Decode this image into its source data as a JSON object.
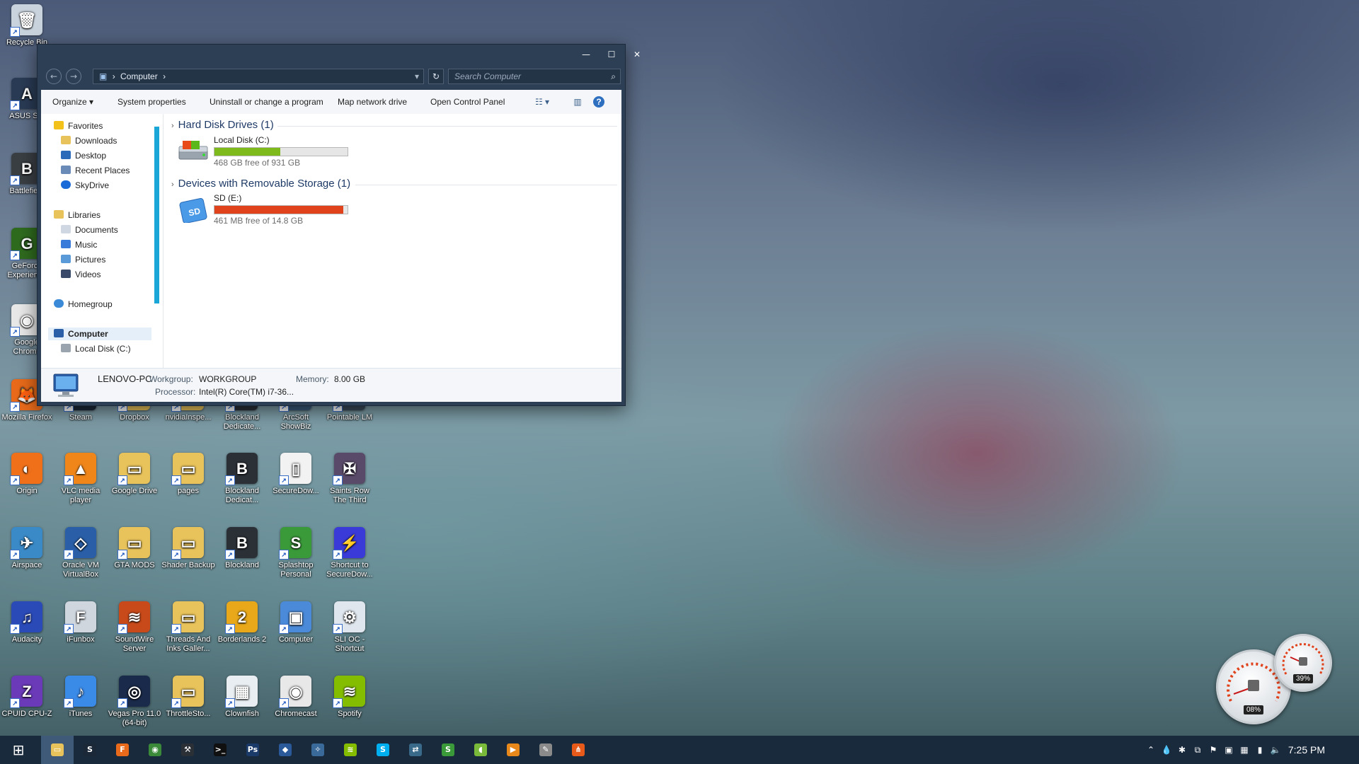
{
  "desktop": {
    "icons": [
      {
        "label": "Recycle Bin",
        "color": "#c9d3dd",
        "glyph": "🗑"
      },
      {
        "label": "ASUS S...",
        "color": "#2a3b55",
        "glyph": "A"
      },
      {
        "label": "Battlefie...",
        "color": "#3a3f44",
        "glyph": "B"
      },
      {
        "label": "GeForce Experience",
        "color": "#2f6b1f",
        "glyph": "G"
      },
      {
        "label": "Google Chrome",
        "color": "#e8e8e8",
        "glyph": "◉"
      },
      {
        "label": "Mozilla Firefox",
        "color": "#e86a1a",
        "glyph": "🦊"
      },
      {
        "label": "Steam",
        "color": "#1b2838",
        "glyph": "S"
      },
      {
        "label": "Dropbox",
        "color": "#e8c25a",
        "glyph": "▭"
      },
      {
        "label": "nvidiaInspe...",
        "color": "#e8c25a",
        "glyph": "▭"
      },
      {
        "label": "Blockland Dedicate...",
        "color": "#2b3037",
        "glyph": "B"
      },
      {
        "label": "ArcSoft ShowBiz",
        "color": "#3a5a7a",
        "glyph": "A"
      },
      {
        "label": "Pointable LM",
        "color": "#3a4a5a",
        "glyph": "P"
      },
      {
        "label": "Origin",
        "color": "#f0701a",
        "glyph": "◐"
      },
      {
        "label": "VLC media player",
        "color": "#f0861a",
        "glyph": "▲"
      },
      {
        "label": "Google Drive",
        "color": "#e8c25a",
        "glyph": "▭"
      },
      {
        "label": "pages",
        "color": "#e8c25a",
        "glyph": "▭"
      },
      {
        "label": "Blockland Dedicat...",
        "color": "#2b3037",
        "glyph": "B"
      },
      {
        "label": "SecureDow...",
        "color": "#f2f2f2",
        "glyph": "▯"
      },
      {
        "label": "Saints Row The Third",
        "color": "#5a4a6a",
        "glyph": "✠"
      },
      {
        "label": "Airspace",
        "color": "#3a8ac8",
        "glyph": "✈"
      },
      {
        "label": "Oracle VM VirtualBox",
        "color": "#2a5fa8",
        "glyph": "◇"
      },
      {
        "label": "GTA MODS",
        "color": "#e8c25a",
        "glyph": "▭"
      },
      {
        "label": "Shader Backup",
        "color": "#e8c25a",
        "glyph": "▭"
      },
      {
        "label": "Blockland",
        "color": "#2b3037",
        "glyph": "B"
      },
      {
        "label": "Splashtop Personal",
        "color": "#3a9a3a",
        "glyph": "S"
      },
      {
        "label": "Shortcut to SecureDow...",
        "color": "#3a3ad8",
        "glyph": "⚡"
      },
      {
        "label": "Audacity",
        "color": "#2a4ab8",
        "glyph": "♫"
      },
      {
        "label": "iFunbox",
        "color": "#cfd6de",
        "glyph": "F"
      },
      {
        "label": "SoundWire Server",
        "color": "#c84a1a",
        "glyph": "≋"
      },
      {
        "label": "Threads And Inks Galler...",
        "color": "#e8c25a",
        "glyph": "▭"
      },
      {
        "label": "Borderlands 2",
        "color": "#e8a81a",
        "glyph": "2"
      },
      {
        "label": "Computer",
        "color": "#4a8ad8",
        "glyph": "▣"
      },
      {
        "label": "SLI OC - Shortcut",
        "color": "#dfe6ee",
        "glyph": "⚙"
      },
      {
        "label": "CPUID CPU-Z",
        "color": "#6a3ab8",
        "glyph": "Z"
      },
      {
        "label": "iTunes",
        "color": "#3a8ae8",
        "glyph": "♪"
      },
      {
        "label": "Vegas Pro 11.0 (64-bit)",
        "color": "#1a2a4a",
        "glyph": "◎"
      },
      {
        "label": "ThrottleSto...",
        "color": "#e8c25a",
        "glyph": "▭"
      },
      {
        "label": "Clownfish",
        "color": "#e8eef2",
        "glyph": "▦"
      },
      {
        "label": "Chromecast",
        "color": "#e8e8e8",
        "glyph": "◉"
      },
      {
        "label": "Spotify",
        "color": "#84bd00",
        "glyph": "≋"
      }
    ]
  },
  "window": {
    "controls": {
      "minimize": "—",
      "maximize": "☐",
      "close": "✕"
    },
    "nav": {
      "back": "←",
      "forward": "→"
    },
    "address": {
      "sep1": "›",
      "location": "Computer",
      "sep2": "›",
      "dropdown": "▾"
    },
    "refresh": "↻",
    "search": {
      "placeholder": "Search Computer",
      "icon": "⌕"
    },
    "toolbar": {
      "organize": "Organize ▾",
      "system_properties": "System properties",
      "uninstall": "Uninstall or change a program",
      "map_drive": "Map network drive",
      "control_panel": "Open Control Panel",
      "view_icon": "☷ ▾",
      "preview_icon": "▥",
      "help_icon": "?"
    },
    "navpane": {
      "favorites": "Favorites",
      "downloads": "Downloads",
      "desktop": "Desktop",
      "recent": "Recent Places",
      "skydrive": "SkyDrive",
      "libraries": "Libraries",
      "documents": "Documents",
      "music": "Music",
      "pictures": "Pictures",
      "videos": "Videos",
      "homegroup": "Homegroup",
      "computer": "Computer",
      "local_disk": "Local Disk (C:)"
    },
    "groups": {
      "hdd": {
        "chevron": "›",
        "title": "Hard Disk Drives (1)"
      },
      "removable": {
        "chevron": "›",
        "title": "Devices with Removable Storage (1)"
      }
    },
    "drives": {
      "c": {
        "name": "Local Disk (C:)",
        "free": "468 GB free of 931 GB",
        "used_fraction": 0.497,
        "bar_color": "#7fba1c"
      },
      "e": {
        "name": "SD (E:)",
        "free": "461 MB free of 14.8 GB",
        "used_fraction": 0.97,
        "bar_color": "#e0421b",
        "icon_text": "SD"
      }
    },
    "details": {
      "pc_name": "LENOVO-PC",
      "workgroup_label": "Workgroup:",
      "workgroup": "WORKGROUP",
      "memory_label": "Memory:",
      "memory": "8.00 GB",
      "processor_label": "Processor:",
      "processor": "Intel(R) Core(TM) i7-36..."
    }
  },
  "taskbar": {
    "start": "⊞",
    "apps": [
      {
        "name": "explorer",
        "color": "#e8c25a",
        "glyph": "▭"
      },
      {
        "name": "steam",
        "color": "#1b2838",
        "glyph": "S"
      },
      {
        "name": "firefox",
        "color": "#e86a1a",
        "glyph": "F"
      },
      {
        "name": "chrome",
        "color": "#3a8a3a",
        "glyph": "◉"
      },
      {
        "name": "tool",
        "color": "#2b3037",
        "glyph": "⚒"
      },
      {
        "name": "terminal",
        "color": "#101010",
        "glyph": ">_"
      },
      {
        "name": "photoshop",
        "color": "#1a3a6a",
        "glyph": "Ps"
      },
      {
        "name": "app",
        "color": "#2a5a9a",
        "glyph": "◆"
      },
      {
        "name": "app2",
        "color": "#3a6a9a",
        "glyph": "✧"
      },
      {
        "name": "spotify",
        "color": "#84bd00",
        "glyph": "≋"
      },
      {
        "name": "skype",
        "color": "#00aff0",
        "glyph": "S"
      },
      {
        "name": "network",
        "color": "#3a6a8a",
        "glyph": "⇄"
      },
      {
        "name": "splashtop",
        "color": "#3a9a3a",
        "glyph": "S"
      },
      {
        "name": "android",
        "color": "#7aba3a",
        "glyph": "◖"
      },
      {
        "name": "media",
        "color": "#e8881a",
        "glyph": "▶"
      },
      {
        "name": "editor",
        "color": "#8a8a8a",
        "glyph": "✎"
      },
      {
        "name": "share",
        "color": "#e85a1a",
        "glyph": "⋔"
      }
    ],
    "tray_icons": [
      "⌃",
      "💧",
      "✱",
      "⧉",
      "⚑",
      "▣",
      "▦",
      "▮",
      "🔈"
    ],
    "clock": "7:25 PM"
  },
  "gadget": {
    "cpu": "08%",
    "ram": "39%"
  }
}
